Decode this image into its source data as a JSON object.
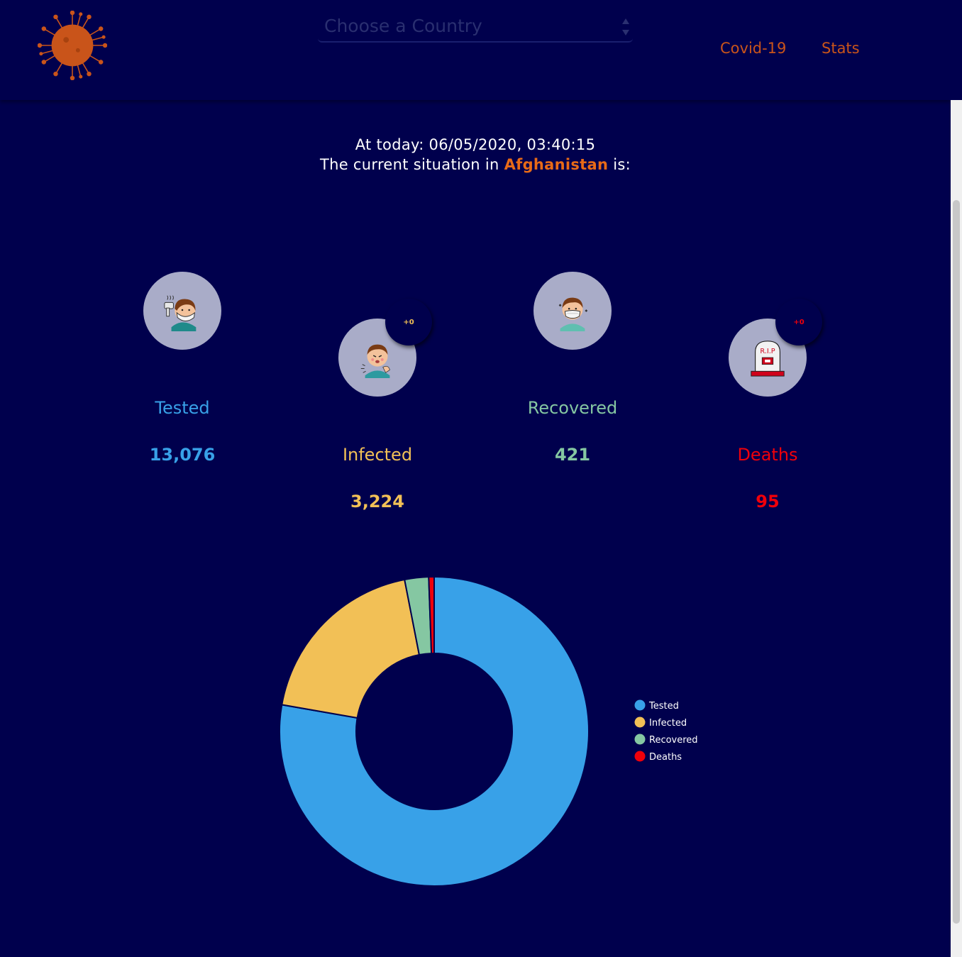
{
  "header": {
    "country_select": {
      "placeholder": "Choose a Country"
    },
    "nav": {
      "covid_label": "Covid-19",
      "stats_label": "Stats"
    }
  },
  "intro": {
    "line1": "At today: 06/05/2020, 03:40:15",
    "line2_prefix": "The current situation in",
    "country": "Afghanistan",
    "line2_suffix": "is:"
  },
  "stats": {
    "tested": {
      "label": "Tested",
      "value": "13,076",
      "color": "#38a1e8",
      "icon": "thermometer-mask-person-icon"
    },
    "infected": {
      "label": "Infected",
      "value": "3,224",
      "color": "#f2c056",
      "icon": "sick-coughing-person-icon",
      "change": "+0"
    },
    "recovered": {
      "label": "Recovered",
      "value": "421",
      "color": "#85c7a2",
      "icon": "masked-person-icon"
    },
    "deaths": {
      "label": "Deaths",
      "value": "95",
      "color": "#f0000a",
      "icon": "tombstone-rip-icon",
      "change": "+0"
    }
  },
  "chart_data": {
    "type": "pie",
    "style": "doughnut",
    "categories": [
      "Tested",
      "Infected",
      "Recovered",
      "Deaths"
    ],
    "values": [
      13076,
      3224,
      421,
      95
    ],
    "colors": [
      "#38a1e8",
      "#f2c056",
      "#85c7a2",
      "#f0000a"
    ],
    "legend_position": "right"
  }
}
